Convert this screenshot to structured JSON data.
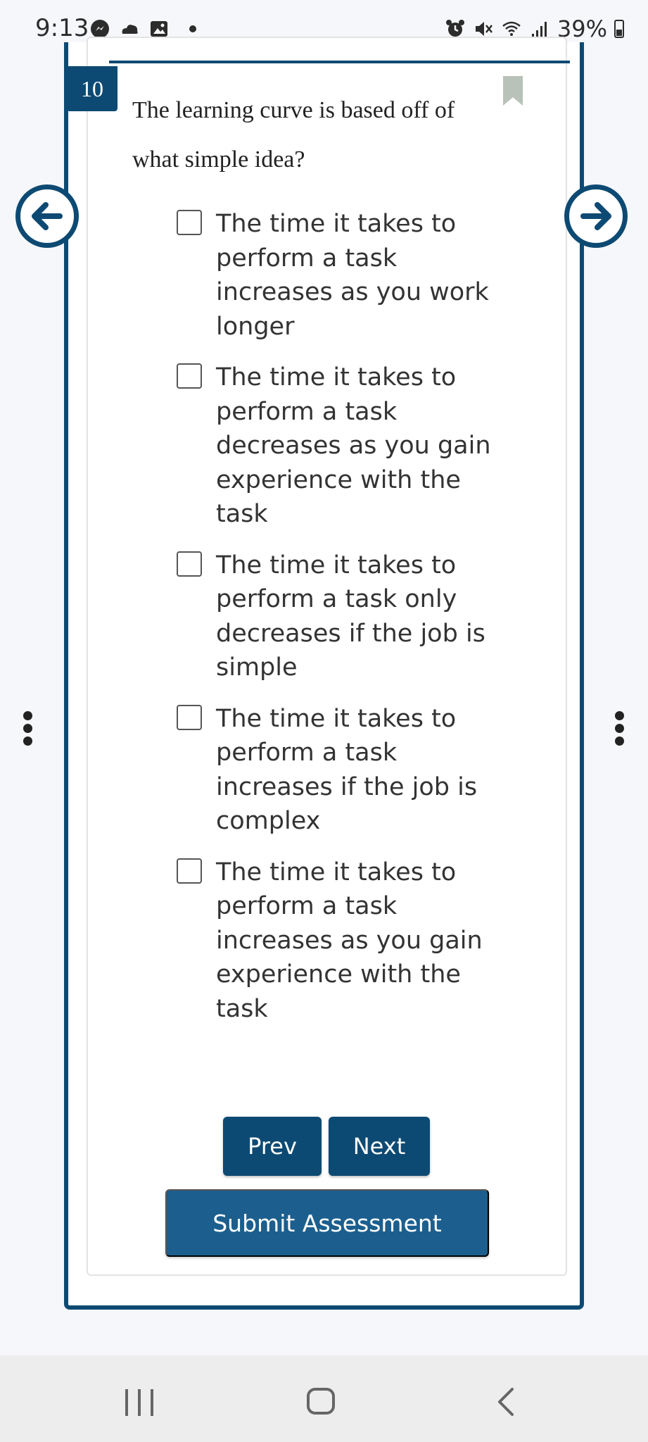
{
  "status_bar": {
    "time": "9:13",
    "battery": "39%"
  },
  "question": {
    "number": "10",
    "text": "The learning curve is based off of what simple idea?"
  },
  "options": [
    {
      "label": "The time it takes to perform a task increases as you work longer",
      "checked": false
    },
    {
      "label": "The time it takes to perform a task decreases as you gain experience with the task",
      "checked": false
    },
    {
      "label": "The time it takes to perform a task only decreases if the job is simple",
      "checked": false
    },
    {
      "label": "The time it takes to perform a task increases if the job is complex",
      "checked": false
    },
    {
      "label": "The time it takes to perform a task increases as you gain experience with the task",
      "checked": false
    }
  ],
  "buttons": {
    "prev": "Prev",
    "next": "Next",
    "submit": "Submit Assessment"
  },
  "icons": {
    "left_arrow": "arrow-left-circle-icon",
    "right_arrow": "arrow-right-circle-icon",
    "bookmark": "bookmark-icon"
  },
  "colors": {
    "primary": "#0d4a73",
    "submit": "#1c5f8e",
    "bookmark": "#b9c2b9"
  }
}
